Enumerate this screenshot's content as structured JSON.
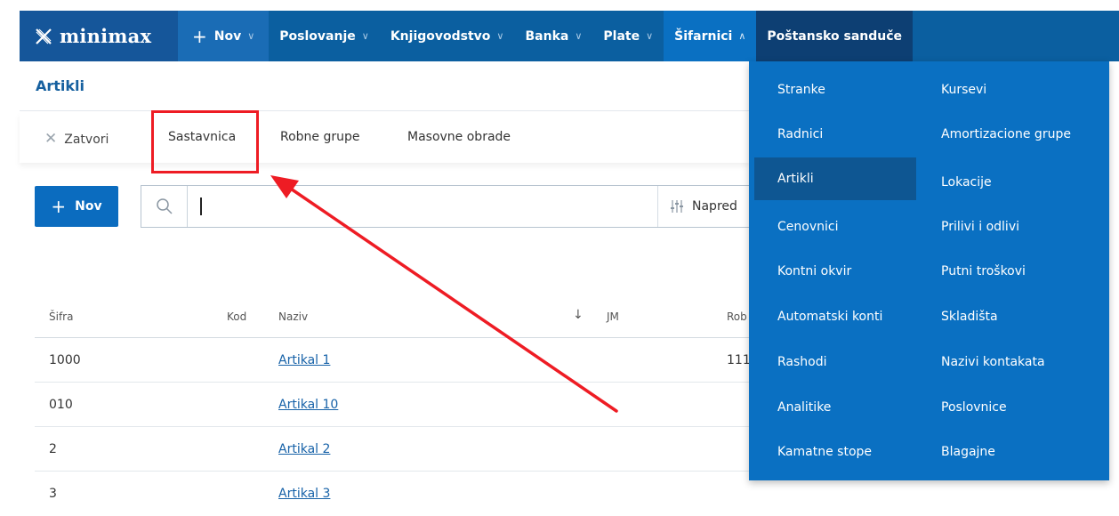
{
  "brand": {
    "name": "minimax"
  },
  "nav": {
    "new_label": "Nov",
    "items": [
      {
        "label": "Poslovanje"
      },
      {
        "label": "Knjigovodstvo"
      },
      {
        "label": "Banka"
      },
      {
        "label": "Plate"
      },
      {
        "label": "Šifarnici"
      },
      {
        "label": "Poštansko sanduče"
      }
    ]
  },
  "page": {
    "title": "Artikli"
  },
  "toolbar": {
    "close_label": "Zatvori",
    "items": [
      {
        "label": "Sastavnica"
      },
      {
        "label": "Robne grupe"
      },
      {
        "label": "Masovne obrade"
      }
    ]
  },
  "actions": {
    "new_label": "Nov"
  },
  "search": {
    "placeholder": "",
    "value": "",
    "advanced_label": "Napred"
  },
  "table": {
    "headers": {
      "sifra": "Šifra",
      "kod": "Kod",
      "naziv": "Naziv",
      "sort": "↓",
      "jm": "JM",
      "rob": "Rob"
    },
    "rows": [
      {
        "sifra": "1000",
        "naziv": "Artikal 1",
        "rob": "111"
      },
      {
        "sifra": "010",
        "naziv": "Artikal 10",
        "rob": ""
      },
      {
        "sifra": "2",
        "naziv": "Artikal 2",
        "rob": ""
      },
      {
        "sifra": "3",
        "naziv": "Artikal 3",
        "rob": ""
      }
    ]
  },
  "dropdown": {
    "left": [
      "Stranke",
      "Radnici",
      "Artikli",
      "Cenovnici",
      "Kontni okvir",
      "Automatski konti",
      "Rashodi",
      "Analitike",
      "Kamatne stope"
    ],
    "right": [
      "Kursevi",
      "Amortizacione grupe",
      "Lokacije",
      "Prilivi i odlivi",
      "Putni troškovi",
      "Skladišta",
      "Nazivi kontakata",
      "Poslovnice",
      "Blagajne"
    ],
    "selected": "Artikli"
  },
  "colors": {
    "nav": "#0b5fa0",
    "dropdown": "#0a70c2",
    "highlight": "#ee1c24",
    "link": "#1762a8"
  }
}
